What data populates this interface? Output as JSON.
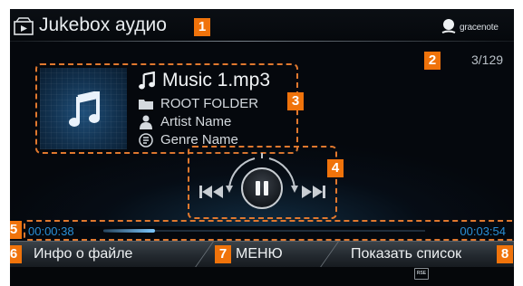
{
  "header": {
    "title": "Jukebox аудио",
    "logo_text": "gracenote",
    "icon": "jukebox-icon"
  },
  "track_counter": "3/129",
  "song": {
    "file_name": "Music 1.mp3",
    "folder": "ROOT FOLDER",
    "artist": "Artist Name",
    "genre": "Genre Name"
  },
  "playback": {
    "elapsed": "00:00:38",
    "total": "00:03:54",
    "progress_fraction": 0.16
  },
  "bottom_bar": {
    "file_info_label": "Инфо о файле",
    "menu_label": "МЕНЮ",
    "show_list_label": "Показать список"
  },
  "badges": {
    "b1": "1",
    "b2": "2",
    "b3": "3",
    "b4": "4",
    "b5": "5",
    "b6": "6",
    "b7": "7",
    "b8": "8"
  },
  "footer": {
    "rse_label": "RSE"
  },
  "colors": {
    "accent": "#f0730b",
    "time_text": "#2a8fd6",
    "background": "#05080d"
  }
}
